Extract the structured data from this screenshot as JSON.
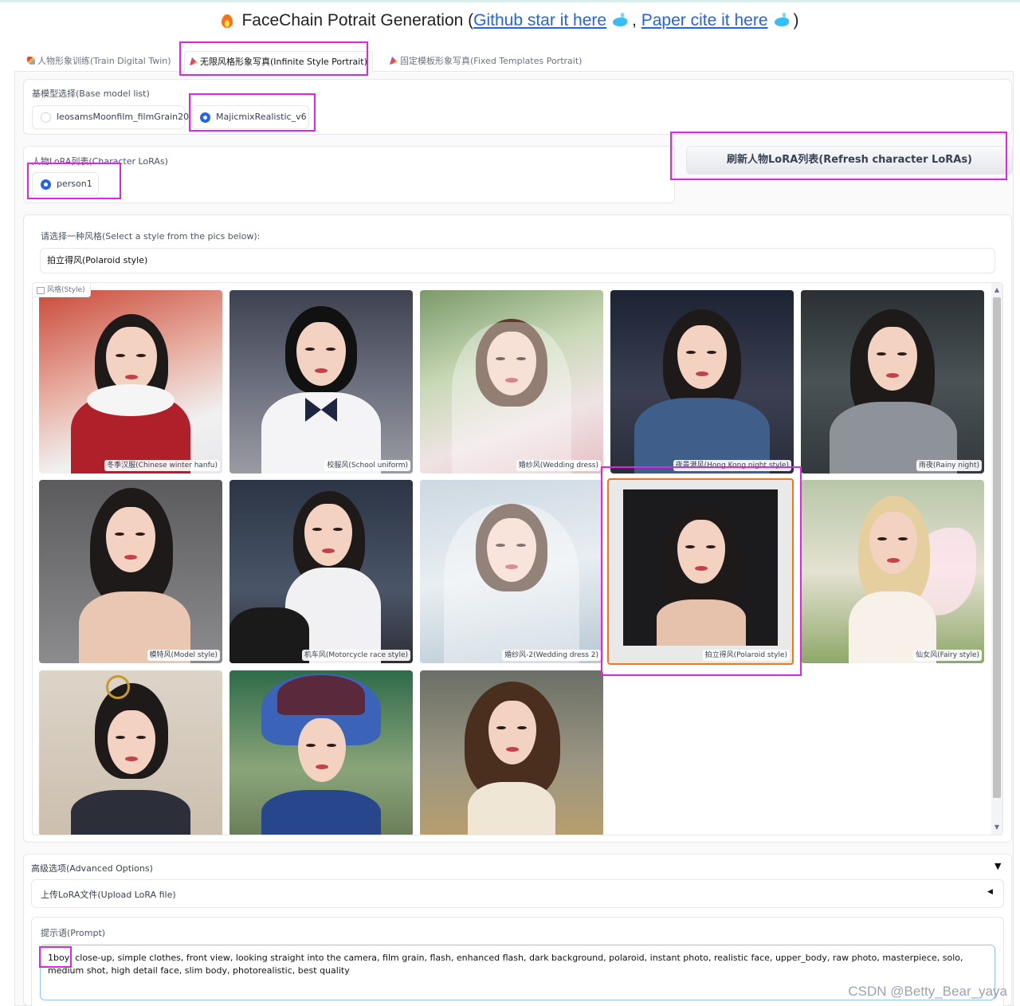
{
  "header": {
    "title": "FaceChain Potrait Generation (",
    "github_link": "Github star it here",
    "separator": ",",
    "paper_link": "Paper cite it here",
    "close": ")"
  },
  "tabs": [
    {
      "label": "人物形象训练(Train Digital Twin)",
      "icon": "rocket-icon"
    },
    {
      "label": "无限风格形象写真(Infinite Style Portrait)",
      "icon": "party-icon",
      "active": true
    },
    {
      "label": "固定模板形象写真(Fixed Templates Portrait)",
      "icon": "party-icon"
    }
  ],
  "base_model": {
    "label": "基模型选择(Base model list)",
    "options": [
      "leosamsMoonfilm_filmGrain20",
      "MajicmixRealistic_v6"
    ],
    "selected": "MajicmixRealistic_v6"
  },
  "character_lora": {
    "label": "人物LoRA列表(Character LoRAs)",
    "options": [
      "person1"
    ],
    "selected": "person1",
    "refresh_button": "刷新人物LoRA列表(Refresh character LoRAs)"
  },
  "style": {
    "label": "请选择一种风格(Select a style from the pics below):",
    "value": "拍立得风(Polaroid style)",
    "gallery_label": "风格(Style)",
    "items": [
      {
        "caption": "冬季汉服(Chinese winter hanfu)"
      },
      {
        "caption": "校服风(School uniform)"
      },
      {
        "caption": "婚纱风(Wedding dress)"
      },
      {
        "caption": "夜景港风(Hong Kong night style)"
      },
      {
        "caption": "雨夜(Rainy night)"
      },
      {
        "caption": "模特风(Model style)"
      },
      {
        "caption": "机车风(Motorcycle race style)"
      },
      {
        "caption": "婚纱风-2(Wedding dress 2)"
      },
      {
        "caption": "拍立得风(Polaroid style)",
        "selected": true
      },
      {
        "caption": "仙女风(Fairy style)"
      },
      {
        "caption": ""
      },
      {
        "caption": ""
      },
      {
        "caption": ""
      }
    ]
  },
  "advanced": {
    "label": "高级选项(Advanced Options)",
    "upload_label": "上传LoRA文件(Upload LoRA file)"
  },
  "prompt": {
    "label": "提示语(Prompt)",
    "value": "1boy, close-up, simple clothes, front view, looking straight into the camera, film grain, flash, enhanced flash, dark background, polaroid, instant photo, realistic face, upper_body, raw photo, masterpiece, solo, medium shot, high detail face, slim body, photorealistic, best quality"
  },
  "watermark": "CSDN @Betty_Bear_yaya",
  "colors": {
    "accent": "#2563eb",
    "highlight": "#e023e6",
    "selected_border": "#f97316"
  }
}
